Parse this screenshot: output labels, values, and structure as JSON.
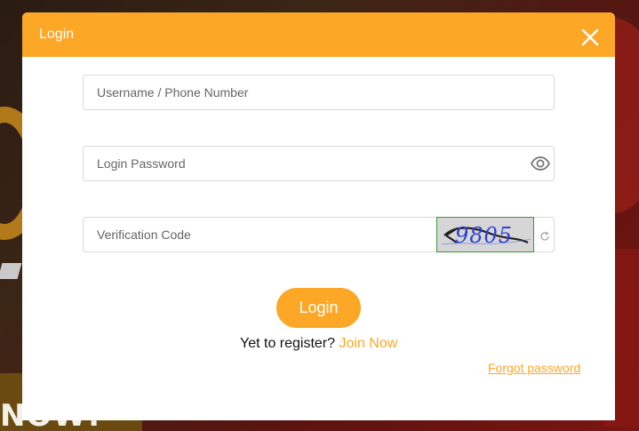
{
  "modal": {
    "title": "Login"
  },
  "form": {
    "username_placeholder": "Username / Phone Number",
    "password_placeholder": "Login Password",
    "captcha_placeholder": "Verification Code",
    "captcha_image_text": "9805",
    "login_button": "Login",
    "register_prompt": "Yet to register?",
    "register_link": "Join Now",
    "forgot_link": "Forgot password"
  },
  "background": {
    "promo_text": "NOW!"
  },
  "icons": {
    "close": "close-icon",
    "password_toggle": "eye-icon",
    "captcha_refresh": "refresh-icon"
  },
  "colors": {
    "accent": "#fda727",
    "header_text": "#ffffff",
    "field_border": "#d9d9d9",
    "captcha_digits": "#2b3fd8"
  }
}
